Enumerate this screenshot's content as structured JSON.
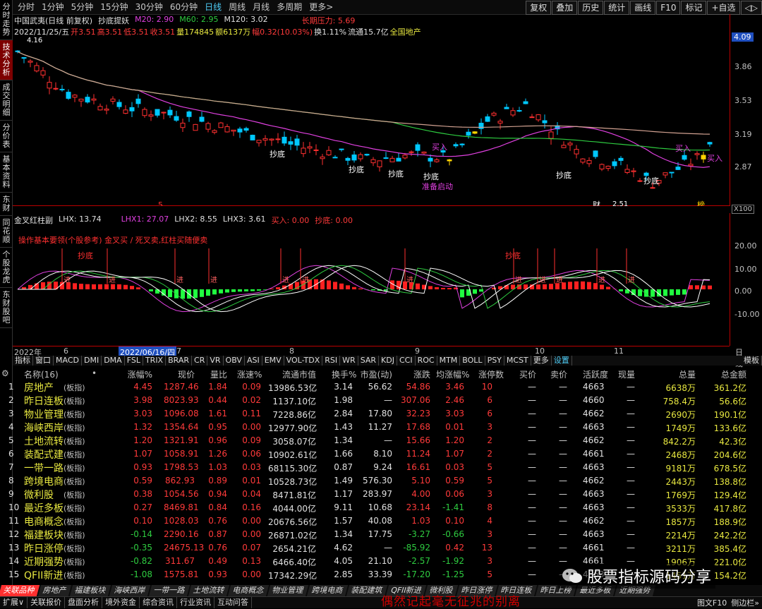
{
  "top_periods": [
    "分时",
    "1分钟",
    "5分钟",
    "15分钟",
    "30分钟",
    "60分钟",
    "日线",
    "周线",
    "月线",
    "多周期",
    "更多>"
  ],
  "top_tools": [
    "复权",
    "叠加",
    "历史",
    "统计",
    "画线",
    "F10",
    "标记",
    "+自选",
    "◁▷"
  ],
  "left_nav": [
    "分时走势",
    "技术分析",
    "成交明细",
    "分价表",
    "基本资料",
    "东财",
    "同花顺",
    "个股龙虎",
    "东财股吧"
  ],
  "header": {
    "line1": "中国武夷(日线 前复权)",
    "indicator": "抄底提妖",
    "m20": "M20: 2.90",
    "m60": "M60: 2.95",
    "m120": "M120: 3.02",
    "pressure": "长期压力: 5.69",
    "line2_date": "2022/11/25/五",
    "open": "开3.51",
    "high": "高3.51",
    "low": "低3.51",
    "close": "收3.51",
    "vol": "量174845",
    "amt": "额6137万",
    "chg": "幅0.32(10.03%)",
    "turnover": "换1.11%",
    "float": "流通15.7亿",
    "sector": "全国地产"
  },
  "axis_main": [
    "4.09",
    "3.86",
    "3.53",
    "3.19",
    "2.87"
  ],
  "price_labels": [
    "4.16",
    "2.51"
  ],
  "main_marks": [
    "抄底",
    "抄底",
    "抄底",
    "抄底",
    "抄底",
    "抄底",
    "买入",
    "买入",
    "买入",
    "准备启动",
    "财",
    "榜",
    "5"
  ],
  "zoom": "X100",
  "sub": {
    "title": "金叉红柱副",
    "lhx": "LHX: 13.74",
    "lhx1": "LHX1: 27.07",
    "lhx2": "LHX2: 8.55",
    "lhx3": "LHX3: 3.61",
    "buy": "买入: 0.00",
    "dip": "抄底: 0.00",
    "note": "操作基本要领(个股参考)  金叉买 / 死叉卖,红柱买随便卖",
    "marks": [
      "抄底",
      "抄底"
    ],
    "axis": [
      "20.00",
      "10.00",
      "0.00",
      "-10.00"
    ]
  },
  "dates": [
    "2022年",
    "6",
    "2022/06/16/四",
    "7",
    "8",
    "9",
    "10",
    "11",
    "日线"
  ],
  "indicators": [
    "指标",
    "窗口",
    "MACD",
    "DMI",
    "DMA",
    "FSL",
    "TRIX",
    "BRAR",
    "CR",
    "VR",
    "OBV",
    "ASI",
    "EMV",
    "VOL-TDX",
    "RSI",
    "WR",
    "SAR",
    "KDJ",
    "CCI",
    "ROC",
    "MTM",
    "BOLL",
    "PSY",
    "MCST",
    "更多",
    "设置",
    "模板"
  ],
  "table": {
    "headers": [
      "",
      "名称(16)",
      "•",
      "涨幅%",
      "现价",
      "量比",
      "涨速%",
      "流通市值",
      "换手%",
      "市盈(动)",
      "涨跌",
      "均涨幅%",
      "涨停数",
      "买价",
      "卖价",
      "活跃度",
      "现量",
      "总量",
      "总金额"
    ],
    "rows": [
      [
        "1",
        "房地产",
        "(板指)",
        "4.45",
        "1287.46",
        "1.84",
        "0.09",
        "13986.53亿",
        "3.14",
        "56.62",
        "54.86",
        "3.46",
        "10",
        "—",
        "—",
        "4663",
        "—",
        "6638万",
        "361.2亿"
      ],
      [
        "2",
        "昨日连板",
        "(板指)",
        "3.98",
        "8023.93",
        "0.44",
        "0.02",
        "1137.10亿",
        "1.98",
        "—",
        "307.06",
        "2.46",
        "6",
        "—",
        "—",
        "4660",
        "—",
        "758.4万",
        "56.6亿"
      ],
      [
        "3",
        "物业管理",
        "(板指)",
        "3.03",
        "1096.08",
        "1.61",
        "0.11",
        "7228.86亿",
        "2.84",
        "17.80",
        "32.23",
        "3.03",
        "6",
        "—",
        "—",
        "4662",
        "—",
        "2690万",
        "190.1亿"
      ],
      [
        "4",
        "海峡西岸",
        "(板指)",
        "1.32",
        "1354.64",
        "0.95",
        "0.00",
        "12977.90亿",
        "1.43",
        "11.27",
        "17.68",
        "0.01",
        "3",
        "—",
        "—",
        "4663",
        "—",
        "1749万",
        "133.6亿"
      ],
      [
        "5",
        "土地流转",
        "(板指)",
        "1.20",
        "1321.91",
        "0.96",
        "0.09",
        "3058.07亿",
        "1.34",
        "—",
        "15.66",
        "1.20",
        "2",
        "—",
        "—",
        "4662",
        "—",
        "842.2万",
        "42.3亿"
      ],
      [
        "6",
        "装配式建",
        "(板指)",
        "1.07",
        "1058.91",
        "1.26",
        "0.06",
        "10902.61亿",
        "1.66",
        "8.10",
        "11.24",
        "1.07",
        "2",
        "—",
        "—",
        "4661",
        "—",
        "2468万",
        "204.6亿"
      ],
      [
        "7",
        "一带一路",
        "(板指)",
        "0.93",
        "1798.53",
        "1.03",
        "0.03",
        "68115.30亿",
        "0.87",
        "9.24",
        "16.61",
        "0.03",
        "5",
        "—",
        "—",
        "4663",
        "—",
        "9181万",
        "678.5亿"
      ],
      [
        "8",
        "跨境电商",
        "(板指)",
        "0.59",
        "862.93",
        "0.89",
        "0.01",
        "10528.73亿",
        "1.49",
        "576.30",
        "5.10",
        "0.59",
        "5",
        "—",
        "—",
        "4662",
        "—",
        "2443万",
        "138.8亿"
      ],
      [
        "9",
        "微利股",
        "(板指)",
        "0.38",
        "1054.56",
        "0.94",
        "0.04",
        "8471.81亿",
        "1.17",
        "283.97",
        "4.00",
        "0.06",
        "3",
        "—",
        "—",
        "4663",
        "—",
        "1769万",
        "129.4亿"
      ],
      [
        "10",
        "最近多板",
        "(板指)",
        "0.27",
        "8469.81",
        "0.84",
        "0.16",
        "4044.00亿",
        "9.11",
        "10.68",
        "23.14",
        "-1.41",
        "8",
        "—",
        "—",
        "4663",
        "—",
        "3533万",
        "417.8亿"
      ],
      [
        "11",
        "电商概念",
        "(板指)",
        "0.10",
        "1028.03",
        "0.76",
        "0.00",
        "20676.56亿",
        "1.57",
        "40.08",
        "1.03",
        "0.10",
        "4",
        "—",
        "—",
        "4662",
        "—",
        "1857万",
        "188.9亿"
      ],
      [
        "12",
        "福建板块",
        "(板指)",
        "-0.14",
        "2290.16",
        "0.87",
        "0.00",
        "26871.02亿",
        "1.34",
        "17.75",
        "-3.27",
        "-0.66",
        "3",
        "—",
        "—",
        "4663",
        "—",
        "2214万",
        "242.2亿"
      ],
      [
        "13",
        "昨日涨停",
        "(板指)",
        "-0.35",
        "24675.13",
        "0.76",
        "0.07",
        "2654.21亿",
        "4.62",
        "—",
        "-85.92",
        "0.42",
        "13",
        "—",
        "—",
        "4661",
        "—",
        "3211万",
        "385.4亿"
      ],
      [
        "14",
        "近期强势",
        "(板指)",
        "-0.82",
        "311.67",
        "0.49",
        "0.13",
        "6466.40亿",
        "4.05",
        "21.10",
        "-2.57",
        "-1.92",
        "3",
        "—",
        "—",
        "4661",
        "—",
        "1906万",
        "221.0亿"
      ],
      [
        "15",
        "QFII新进",
        "(板指)",
        "-1.08",
        "1575.81",
        "0.93",
        "0.00",
        "17342.29亿",
        "2.85",
        "33.39",
        "-17.20",
        "-1.25",
        "5",
        "—",
        "—",
        "4663",
        "—",
        "1451万",
        "154.2亿"
      ]
    ]
  },
  "bottom_tabs": [
    "关联品种",
    "房地产",
    "福建板块",
    "海峡西岸",
    "一带一路",
    "土地流转",
    "电商概念",
    "物业管理",
    "跨境电商",
    "装配建筑",
    "QFII新进",
    "微利股",
    "昨日涨停",
    "昨日连板",
    "昨日上榜",
    "最近多板",
    "近期强势"
  ],
  "bottom_bar": [
    "扩展∨",
    "关联报价",
    "盘面分析",
    "境外资金",
    "综合资讯",
    "行业资讯",
    "互动问答"
  ],
  "bottom_right": [
    "图文F10",
    "侧边栏»"
  ],
  "watermark": "股票指标源码分享",
  "footer_text": "偶然记起毫无征兆的别离"
}
